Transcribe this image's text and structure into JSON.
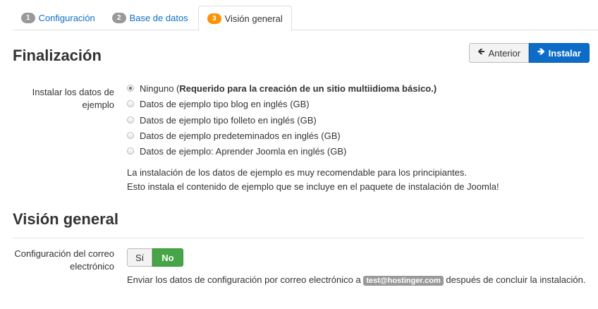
{
  "tabs": [
    {
      "num": "1",
      "label": "Configuración"
    },
    {
      "num": "2",
      "label": "Base de datos"
    },
    {
      "num": "3",
      "label": "Visión general"
    }
  ],
  "finalization": {
    "title": "Finalización",
    "prev_button": "Anterior",
    "install_button": "Instalar",
    "sample_label": "Instalar los datos de ejemplo",
    "options": [
      {
        "label": "Ninguno (",
        "bold": "Requerido para la creación de un sitio multiidioma básico.)",
        "checked": true
      },
      {
        "label": "Datos de ejemplo tipo blog en inglés (GB)"
      },
      {
        "label": "Datos de ejemplo tipo folleto en inglés (GB)"
      },
      {
        "label": "Datos de ejemplo predeteminados en inglés (GB)"
      },
      {
        "label": "Datos de ejemplo: Aprender Joomla en inglés (GB)"
      }
    ],
    "help_line1": "La instalación de los datos de ejemplo es muy recomendable para los principiantes.",
    "help_line2": "Esto instala el contenido de ejemplo que se incluye en el paquete de instalación de Joomla!"
  },
  "overview": {
    "title": "Visión general",
    "email_label": "Configuración del correo electrónico",
    "yes": "Sí",
    "no": "No",
    "selected": "No",
    "email_text_before": "Enviar los datos de configuración por correo electrónico a",
    "email": "test@hostinger.com",
    "email_text_after": "después de concluir la instalación."
  }
}
